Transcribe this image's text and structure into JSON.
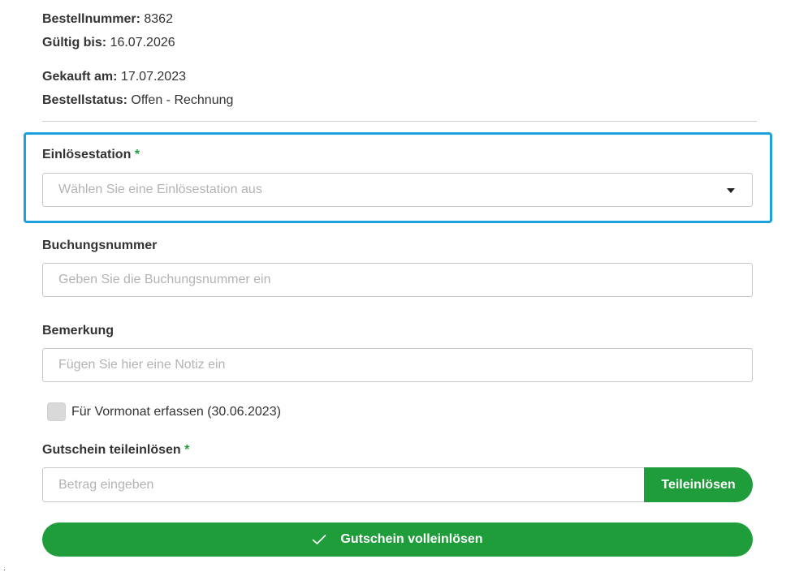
{
  "order": {
    "number_label": "Bestellnummer:",
    "number_value": "8362",
    "valid_label": "Gültig bis:",
    "valid_value": "16.07.2026",
    "bought_label": "Gekauft am:",
    "bought_value": "17.07.2023",
    "status_label": "Bestellstatus:",
    "status_value": "Offen - Rechnung"
  },
  "form": {
    "station": {
      "label": "Einlösestation",
      "required_mark": "*",
      "placeholder": "Wählen Sie eine Einlösestation aus"
    },
    "booking": {
      "label": "Buchungsnummer",
      "placeholder": "Geben Sie die Buchungsnummer ein"
    },
    "note": {
      "label": "Bemerkung",
      "placeholder": "Fügen Sie hier eine Notiz ein"
    },
    "previous_month": {
      "label": "Für Vormonat erfassen (30.06.2023)",
      "checked": false
    },
    "partial": {
      "label": "Gutschein teileinlösen",
      "required_mark": "*",
      "placeholder": "Betrag eingeben",
      "button_label": "Teileinlösen"
    },
    "full_button_label": "Gutschein volleinlösen"
  },
  "colors": {
    "accent_green": "#1e9d3a",
    "focus_blue": "#1da1dc"
  },
  "icons": {
    "full_button": "check-icon",
    "select": "caret-down-icon"
  }
}
